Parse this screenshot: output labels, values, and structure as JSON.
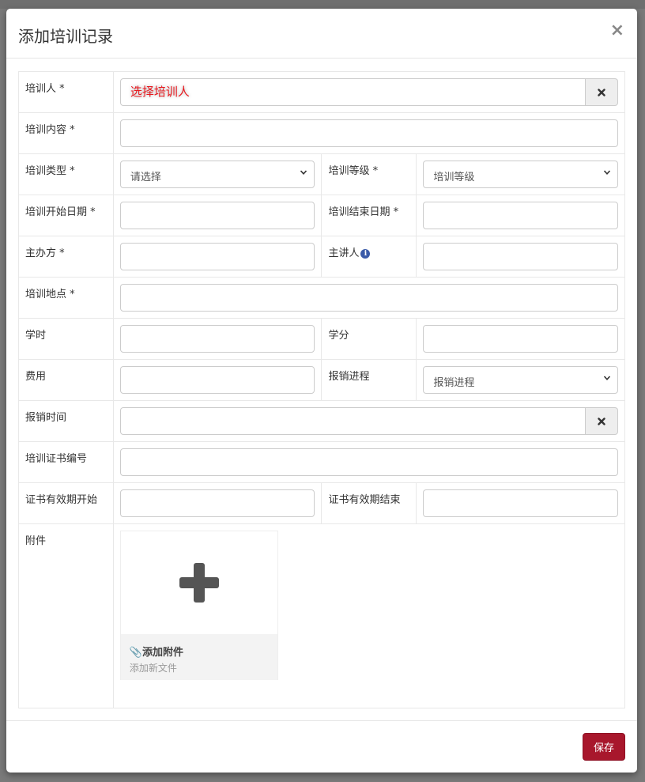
{
  "dialog": {
    "title": "添加培训记录",
    "close_label": "×",
    "save_label": "保存"
  },
  "form": {
    "trainee": {
      "label": "培训人 *",
      "value": "选择培训人"
    },
    "content": {
      "label": "培训内容 *",
      "value": ""
    },
    "type": {
      "label": "培训类型 *",
      "selected": "请选择"
    },
    "level": {
      "label": "培训等级 *",
      "selected": "培训等级"
    },
    "start_date": {
      "label": "培训开始日期 *",
      "value": ""
    },
    "end_date": {
      "label": "培训结束日期 *",
      "value": ""
    },
    "organizer": {
      "label": "主办方 *",
      "value": ""
    },
    "speaker": {
      "label": "主讲人",
      "value": ""
    },
    "location": {
      "label": "培训地点 *",
      "value": ""
    },
    "hours": {
      "label": "学时",
      "value": ""
    },
    "credits": {
      "label": "学分",
      "value": ""
    },
    "cost": {
      "label": "费用",
      "value": ""
    },
    "reimburse_progress": {
      "label": "报销进程",
      "selected": "报销进程"
    },
    "reimburse_time": {
      "label": "报销时间",
      "value": ""
    },
    "certificate_no": {
      "label": "培训证书编号",
      "value": ""
    },
    "cert_valid_start": {
      "label": "证书有效期开始",
      "value": ""
    },
    "cert_valid_end": {
      "label": "证书有效期结束",
      "value": ""
    },
    "attachment": {
      "label": "附件",
      "add_title": "📎添加附件",
      "add_subtitle": "添加新文件"
    }
  },
  "colors": {
    "save_button": "#a8172c",
    "info_icon": "#3b5ba9",
    "placeholder_red": "#e8191f"
  },
  "icons": {
    "close": "close-icon",
    "clear": "clear-x-icon",
    "info": "info-icon",
    "chevron": "chevron-down-icon",
    "plus": "plus-icon",
    "paperclip": "paperclip-icon"
  }
}
